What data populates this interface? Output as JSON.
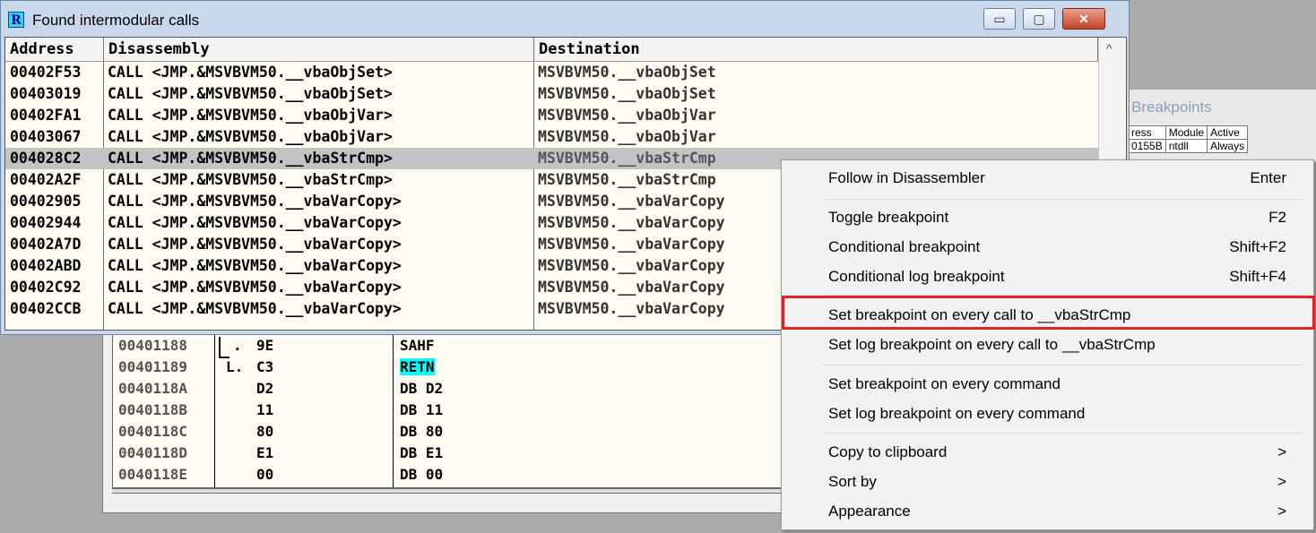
{
  "calls_window": {
    "title": "Found intermodular calls",
    "icon_letter": "R",
    "buttons": {
      "minimize": "▭",
      "maximize": "▢",
      "close": "✕"
    },
    "columns": [
      "Address",
      "Disassembly",
      "Destination"
    ],
    "rows": [
      {
        "address": "00402F53",
        "disassembly": "CALL <JMP.&MSVBVM50.__vbaObjSet>",
        "destination": "MSVBVM50.__vbaObjSet"
      },
      {
        "address": "00403019",
        "disassembly": "CALL <JMP.&MSVBVM50.__vbaObjSet>",
        "destination": "MSVBVM50.__vbaObjSet"
      },
      {
        "address": "00402FA1",
        "disassembly": "CALL <JMP.&MSVBVM50.__vbaObjVar>",
        "destination": "MSVBVM50.__vbaObjVar"
      },
      {
        "address": "00403067",
        "disassembly": "CALL <JMP.&MSVBVM50.__vbaObjVar>",
        "destination": "MSVBVM50.__vbaObjVar"
      },
      {
        "address": "004028C2",
        "disassembly": "CALL <JMP.&MSVBVM50.__vbaStrCmp>",
        "destination": "MSVBVM50.__vbaStrCmp"
      },
      {
        "address": "00402A2F",
        "disassembly": "CALL <JMP.&MSVBVM50.__vbaStrCmp>",
        "destination": "MSVBVM50.__vbaStrCmp"
      },
      {
        "address": "00402905",
        "disassembly": "CALL <JMP.&MSVBVM50.__vbaVarCopy>",
        "destination": "MSVBVM50.__vbaVarCopy"
      },
      {
        "address": "00402944",
        "disassembly": "CALL <JMP.&MSVBVM50.__vbaVarCopy>",
        "destination": "MSVBVM50.__vbaVarCopy"
      },
      {
        "address": "00402A7D",
        "disassembly": "CALL <JMP.&MSVBVM50.__vbaVarCopy>",
        "destination": "MSVBVM50.__vbaVarCopy"
      },
      {
        "address": "00402ABD",
        "disassembly": "CALL <JMP.&MSVBVM50.__vbaVarCopy>",
        "destination": "MSVBVM50.__vbaVarCopy"
      },
      {
        "address": "00402C92",
        "disassembly": "CALL <JMP.&MSVBVM50.__vbaVarCopy>",
        "destination": "MSVBVM50.__vbaVarCopy"
      },
      {
        "address": "00402CCB",
        "disassembly": "CALL <JMP.&MSVBVM50.__vbaVarCopy>",
        "destination": "MSVBVM50.__vbaVarCopy"
      }
    ],
    "selected_row": 4
  },
  "disasm_window": {
    "rows": [
      {
        "address": "00401188",
        "prefix": ".",
        "bytes": "9E",
        "instruction": "SAHF"
      },
      {
        "address": "00401189",
        "prefix": "L.",
        "bytes": "C3",
        "instruction": "RETN"
      },
      {
        "address": "0040118A",
        "prefix": "",
        "bytes": "D2",
        "instruction": "DB D2"
      },
      {
        "address": "0040118B",
        "prefix": "",
        "bytes": "11",
        "instruction": "DB 11"
      },
      {
        "address": "0040118C",
        "prefix": "",
        "bytes": "80",
        "instruction": "DB 80"
      },
      {
        "address": "0040118D",
        "prefix": "",
        "bytes": "E1",
        "instruction": "DB E1"
      },
      {
        "address": "0040118E",
        "prefix": "",
        "bytes": "00",
        "instruction": "DB 00"
      }
    ],
    "highlight_color": "#00ffff"
  },
  "breakpoints_window": {
    "title": "Breakpoints",
    "columns": [
      "ress",
      "Module",
      "Active"
    ],
    "rows": [
      {
        "addr": "0155B",
        "module": "ntdll",
        "active": "Always"
      }
    ]
  },
  "context_menu": {
    "items": [
      {
        "label": "Follow in Disassembler",
        "shortcut": "Enter"
      },
      {
        "label": "Toggle breakpoint",
        "shortcut": "F2"
      },
      {
        "label": "Conditional breakpoint",
        "shortcut": "Shift+F2"
      },
      {
        "label": "Conditional log breakpoint",
        "shortcut": "Shift+F4"
      },
      {
        "label": "Set breakpoint on every call to __vbaStrCmp",
        "shortcut": ""
      },
      {
        "label": "Set log breakpoint on every call to __vbaStrCmp",
        "shortcut": ""
      },
      {
        "label": "Set breakpoint on every command",
        "shortcut": ""
      },
      {
        "label": "Set log breakpoint on every command",
        "shortcut": ""
      },
      {
        "label": "Copy to clipboard",
        "shortcut": ">"
      },
      {
        "label": "Sort by",
        "shortcut": ">"
      },
      {
        "label": "Appearance",
        "shortcut": ">"
      }
    ],
    "highlight_color": "#e0222a"
  }
}
